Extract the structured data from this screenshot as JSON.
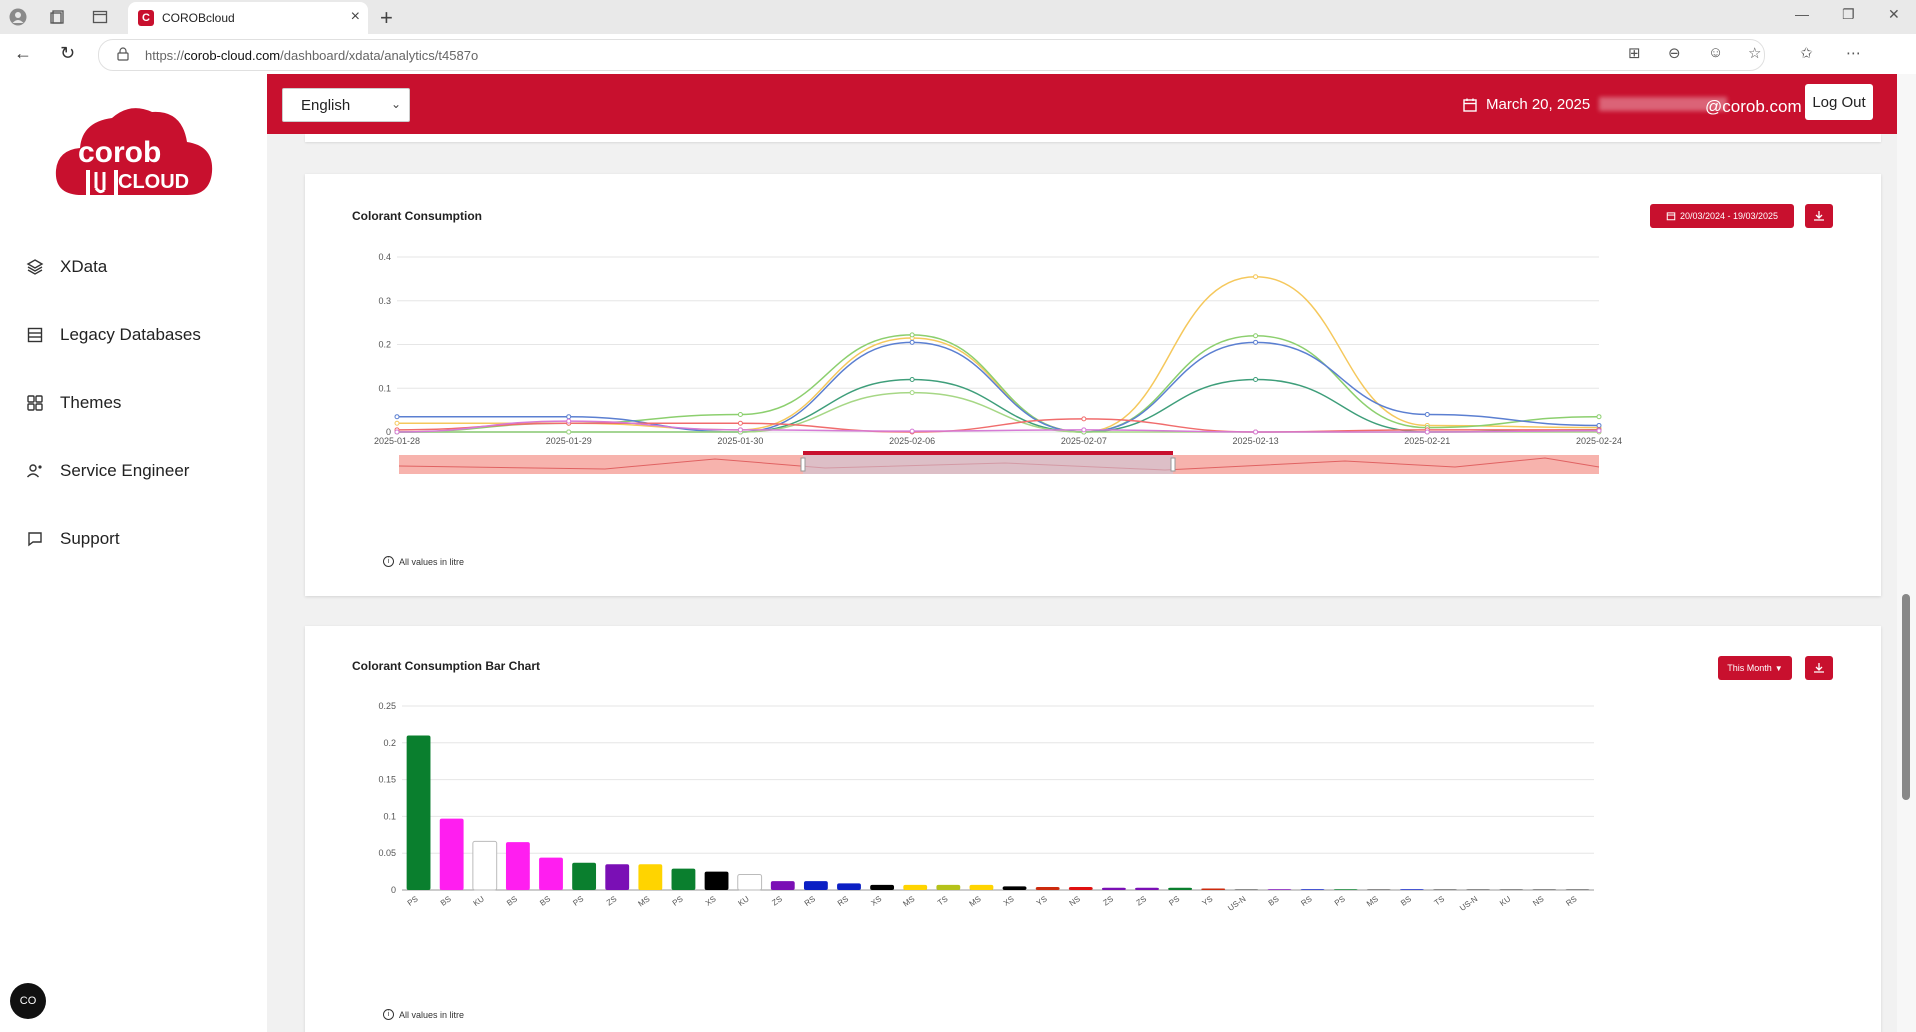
{
  "browser": {
    "tab_title": "COROBcloud",
    "url_prefix": "https://",
    "url_host": "corob-cloud.com",
    "url_path": "/dashboard/xdata/analytics/t4587o"
  },
  "sidebar": {
    "items": [
      {
        "label": "XData",
        "icon": "layers-icon"
      },
      {
        "label": "Legacy Databases",
        "icon": "database-icon"
      },
      {
        "label": "Themes",
        "icon": "grid-icon"
      },
      {
        "label": "Service Engineer",
        "icon": "engineer-icon"
      },
      {
        "label": "Support",
        "icon": "chat-icon"
      }
    ],
    "logo_line1": "corob",
    "logo_line2": "CLOUD"
  },
  "header": {
    "language": "English",
    "date": "March 20, 2025",
    "email_visible": "@corob.com",
    "logout_label": "Log Out"
  },
  "line_card": {
    "title": "Colorant Consumption",
    "date_range": "20/03/2024 - 19/03/2025",
    "note": "All values in litre"
  },
  "bar_card": {
    "title": "Colorant Consumption Bar Chart",
    "period": "This Month",
    "note": "All values in litre"
  },
  "colors": {
    "brand": "#c8102e"
  },
  "chart_data": [
    {
      "type": "line",
      "title": "Colorant Consumption",
      "x": [
        "2025-01-28",
        "2025-01-29",
        "2025-01-30",
        "2025-02-06",
        "2025-02-07",
        "2025-02-13",
        "2025-02-21",
        "2025-02-24"
      ],
      "yticks": [
        "0",
        "0.1",
        "0.2",
        "0.3",
        "0.4"
      ],
      "ylim": [
        0,
        0.4
      ],
      "series": [
        {
          "color": "#f5c85c",
          "values": [
            0.02,
            0.02,
            0.005,
            0.215,
            0.0,
            0.355,
            0.015,
            0.01
          ]
        },
        {
          "color": "#8ccf6e",
          "values": [
            0.0,
            0.02,
            0.04,
            0.222,
            0.0,
            0.22,
            0.01,
            0.035
          ]
        },
        {
          "color": "#5b7fd1",
          "values": [
            0.035,
            0.035,
            0.0,
            0.205,
            0.0,
            0.205,
            0.04,
            0.015
          ]
        },
        {
          "color": "#3e9e7a",
          "values": [
            0.0,
            0.0,
            0.0,
            0.12,
            0.0,
            0.12,
            0.0,
            0.005
          ]
        },
        {
          "color": "#a6d785",
          "values": [
            0.0,
            0.0,
            0.0,
            0.09,
            0.0,
            0.0,
            0.0,
            0.0
          ]
        },
        {
          "color": "#f06c6c",
          "values": [
            0.005,
            0.02,
            0.02,
            0.0,
            0.03,
            0.0,
            0.005,
            0.005
          ]
        },
        {
          "color": "#d67ad6",
          "values": [
            0.0,
            0.025,
            0.005,
            0.002,
            0.005,
            0.0,
            0.0,
            0.003
          ]
        }
      ],
      "note": "All values in litre"
    },
    {
      "type": "bar",
      "title": "Colorant Consumption Bar Chart",
      "ylim": [
        0,
        0.25
      ],
      "yticks": [
        "0",
        "0.05",
        "0.1",
        "0.15",
        "0.2",
        "0.25"
      ],
      "categories": [
        "PS",
        "BS",
        "KU",
        "BS",
        "BS",
        "PS",
        "ZS",
        "MS",
        "PS",
        "XS",
        "KU",
        "ZS",
        "RS",
        "RS",
        "XS",
        "MS",
        "TS",
        "MS",
        "XS",
        "YS",
        "NS",
        "ZS",
        "ZS",
        "PS",
        "YS",
        "US-N",
        "BS",
        "RS",
        "PS",
        "MS",
        "BS",
        "TS",
        "US-N",
        "KU",
        "NS",
        "RS"
      ],
      "values": [
        0.21,
        0.097,
        0.066,
        0.065,
        0.044,
        0.037,
        0.035,
        0.035,
        0.029,
        0.025,
        0.021,
        0.012,
        0.012,
        0.009,
        0.007,
        0.007,
        0.007,
        0.007,
        0.005,
        0.004,
        0.004,
        0.003,
        0.003,
        0.003,
        0.002,
        0.001,
        0.001,
        0.001,
        0.001,
        0.001,
        0.001,
        0.001,
        0.001,
        0.001,
        0.001,
        0.001
      ],
      "bar_colors": [
        "#0a7f2e",
        "#ff1ef0",
        "#ffffff",
        "#ff1ef0",
        "#ff1ef0",
        "#0a7f2e",
        "#7a0fb5",
        "#ffd400",
        "#0a7f2e",
        "#000000",
        "#ffffff",
        "#7a0fb5",
        "#0b1fc4",
        "#0b1fc4",
        "#000000",
        "#ffd400",
        "#b5c21a",
        "#ffd400",
        "#000000",
        "#cc2a0d",
        "#e01010",
        "#7a0fb5",
        "#7a0fb5",
        "#0a7f2e",
        "#cc2a0d",
        "#666666",
        "#7a0fb5",
        "#0b1fc4",
        "#0a7f2e",
        "#666666",
        "#0b1fc4",
        "#666666",
        "#666666",
        "#666666",
        "#666666",
        "#666666"
      ],
      "note": "All values in litre"
    }
  ]
}
